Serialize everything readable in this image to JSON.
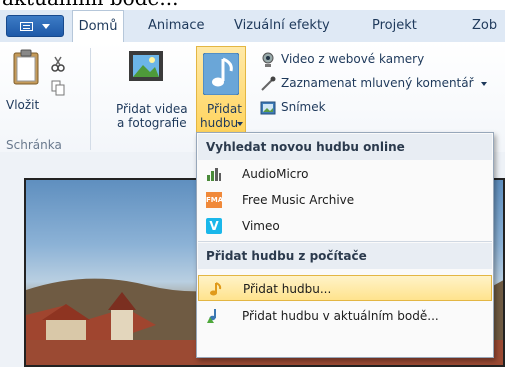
{
  "top_strip_text": "aktuálním bodě...",
  "tabs": [
    {
      "label": "Domů"
    },
    {
      "label": "Animace"
    },
    {
      "label": "Vizuální efekty"
    },
    {
      "label": "Projekt"
    },
    {
      "label": "Zob"
    }
  ],
  "ribbon": {
    "clipboard": {
      "paste_label": "Vložit",
      "group_label": "Schránka"
    },
    "add_videos_label_line1": "Přidat videa",
    "add_videos_label_line2": "a fotografie",
    "add_music_label_line1": "Přidat",
    "add_music_label_line2": "hudbu",
    "webcam_label": "Video z webové kamery",
    "narration_label": "Zaznamenat mluvený komentář",
    "snapshot_label": "Snímek"
  },
  "menu": {
    "header_online": "Vyhledat novou hudbu online",
    "online_items": [
      {
        "label": "AudioMicro",
        "icon": "audiomicro-icon"
      },
      {
        "label": "Free Music Archive",
        "icon": "fma-icon",
        "icon_text": "FMA"
      },
      {
        "label": "Vimeo",
        "icon": "vimeo-icon",
        "icon_text": "V"
      }
    ],
    "header_local": "Přidat hudbu z počítače",
    "local_items": [
      {
        "label": "Přidat hudbu...",
        "icon": "music-note-icon"
      },
      {
        "label": "Přidat hudbu v aktuálním bodě...",
        "icon": "music-note-plus-icon"
      }
    ]
  },
  "colors": {
    "accent": "#1e59a8",
    "highlight": "#ffd45e",
    "tab_text": "#1e395b"
  }
}
